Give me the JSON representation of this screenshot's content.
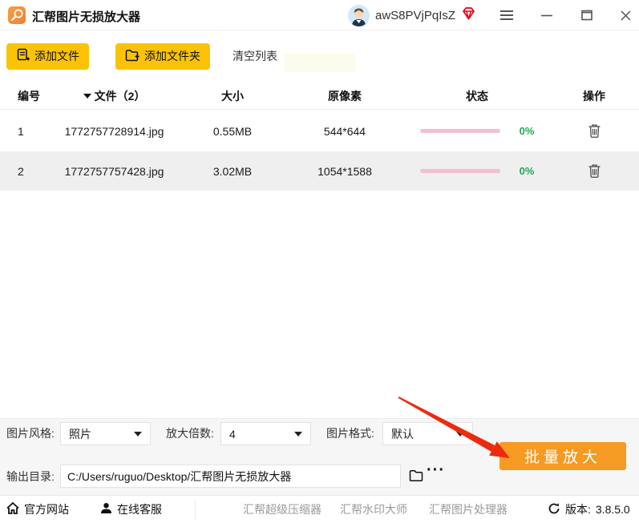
{
  "titlebar": {
    "title": "汇帮图片无损放大器",
    "username": "awS8PVjPqIsZ"
  },
  "toolbar": {
    "add_file": "添加文件",
    "add_folder": "添加文件夹",
    "clear_list": "清空列表"
  },
  "table": {
    "headers": {
      "index": "编号",
      "file": "文件（2）",
      "size": "大小",
      "pixels": "原像素",
      "status": "状态",
      "action": "操作"
    },
    "rows": [
      {
        "index": "1",
        "filename": "1772757728914.jpg",
        "size": "0.55MB",
        "pixels": "544*644",
        "percent": "0%"
      },
      {
        "index": "2",
        "filename": "1772757757428.jpg",
        "size": "3.02MB",
        "pixels": "1054*1588",
        "percent": "0%"
      }
    ]
  },
  "controls": {
    "style_label": "图片风格:",
    "style_value": "照片",
    "factor_label": "放大倍数:",
    "factor_value": "4",
    "format_label": "图片格式:",
    "format_value": "默认",
    "batch_button": "批量放大",
    "output_label": "输出目录:",
    "output_path": "C:/Users/ruguo/Desktop/汇帮图片无损放大器",
    "browse_more": "···"
  },
  "footer": {
    "official_site": "官方网站",
    "online_service": "在线客服",
    "links": [
      "汇帮超级压缩器",
      "汇帮水印大师",
      "汇帮图片处理器"
    ],
    "version_label": "版本:",
    "version": "3.8.5.0"
  },
  "colors": {
    "accent_yellow": "#fcc306",
    "accent_orange": "#f59a23",
    "progress_pink": "#f4bfce",
    "percent_green": "#1fa84f",
    "vip_red": "#e60012",
    "arrow_red": "#ec2b0e"
  }
}
